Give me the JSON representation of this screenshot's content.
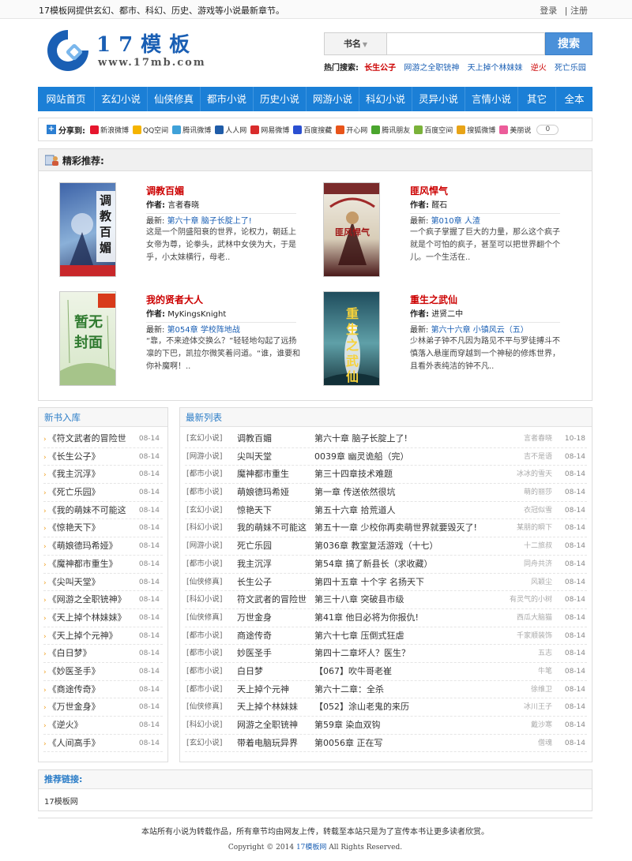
{
  "topbar": {
    "slogan": "17模板网提供玄幻、都市、科幻、历史、游戏等小说最新章节。",
    "login": "登录",
    "sep": "|",
    "register": "注册"
  },
  "logo": {
    "name": "17模板",
    "url": "www.17mb.com"
  },
  "search": {
    "type_label": "书名",
    "value": "",
    "button": "搜索"
  },
  "hot": {
    "label": "热门搜索:",
    "keywords": [
      {
        "text": "长生公子",
        "color": "#cc0000"
      },
      {
        "text": "网游之全职铳神",
        "color": "#1a5fb4"
      },
      {
        "text": "天上掉个林妹妹",
        "color": "#1a5fb4"
      },
      {
        "text": "逆火",
        "color": "#cc0000"
      },
      {
        "text": "死亡乐园",
        "color": "#1a5fb4"
      }
    ]
  },
  "nav": [
    "网站首页",
    "玄幻小说",
    "仙侠修真",
    "都市小说",
    "历史小说",
    "网游小说",
    "科幻小说",
    "灵异小说",
    "言情小说",
    "其它",
    "全本"
  ],
  "share": {
    "label": "分享到:",
    "sites": [
      {
        "text": "新浪微博",
        "color": "#e6162d"
      },
      {
        "text": "QQ空间",
        "color": "#f5b400"
      },
      {
        "text": "腾讯微博",
        "color": "#3fa1d8"
      },
      {
        "text": "人人网",
        "color": "#1f5ca8"
      },
      {
        "text": "网易微博",
        "color": "#d92c2c"
      },
      {
        "text": "百度搜藏",
        "color": "#2a4fd1"
      },
      {
        "text": "开心网",
        "color": "#e8541a"
      },
      {
        "text": "腾讯朋友",
        "color": "#4aa52e"
      },
      {
        "text": "百度空间",
        "color": "#7ab23a"
      },
      {
        "text": "搜狐微博",
        "color": "#e8a417"
      },
      {
        "text": "美丽说",
        "color": "#ec5c9a"
      }
    ],
    "count": "0"
  },
  "recommend": {
    "title": "精彩推荐:",
    "books": [
      {
        "title": "调教百媚",
        "author_label": "作者:",
        "author": "言者春晓",
        "latest_label": "最新:",
        "latest": "第六十章 脑子长腚上了!",
        "desc": "这是一个阴盛阳衰的世界，论权力，朝廷上女帝为尊，论拳头，武林中女侠为大，于是乎，小太妹横行，母老..",
        "cover_text": "调教百媚",
        "cover_bg": "#4a6fb0"
      },
      {
        "title": "匪风悍气",
        "author_label": "作者:",
        "author": "醛石",
        "latest_label": "最新:",
        "latest": "第010章 人渣",
        "desc": "一个疯子掌握了巨大的力量，那么这个疯子就是个可怕的疯子，甚至可以把世界翻个个儿。一个生活在..",
        "cover_text": "匪风悍气",
        "cover_bg": "#7a2b2b"
      },
      {
        "title": "我的贤者大人",
        "author_label": "作者:",
        "author": "MyKingsKnight",
        "latest_label": "最新:",
        "latest": "第054章 学校阵地战",
        "desc": "“靠，不来迹体交换么？”轻轻地勾起了远扬凛的下巴，凯拉尔微笑着问道。“谁，谁要和你补魔啊！..",
        "cover_text": "暂无封面",
        "cover_bg": "#e8f0e0"
      },
      {
        "title": "重生之武仙",
        "author_label": "作者:",
        "author": "进贤二中",
        "latest_label": "最新:",
        "latest": "第六十六章 小镇风云（五）",
        "desc": "少林弟子钟不凡因为路见不平与罗徒搏斗不慎落入悬崖而穿越到一个神秘的修炼世界，且看外表纯洁的钟不凡..",
        "cover_text": "重生之武仙",
        "cover_bg": "#2c6a7a"
      }
    ]
  },
  "new_books": {
    "title": "新书入库",
    "items": [
      {
        "name": "《符文武者的冒险世",
        "date": "08-14"
      },
      {
        "name": "《长生公子》",
        "date": "08-14"
      },
      {
        "name": "《我主沉浮》",
        "date": "08-14"
      },
      {
        "name": "《死亡乐园》",
        "date": "08-14"
      },
      {
        "name": "《我的萌妹不可能这",
        "date": "08-14"
      },
      {
        "name": "《惊艳天下》",
        "date": "08-14"
      },
      {
        "name": "《萌娘德玛希娅》",
        "date": "08-14"
      },
      {
        "name": "《魔神都市重生》",
        "date": "08-14"
      },
      {
        "name": "《尖叫天堂》",
        "date": "08-14"
      },
      {
        "name": "《网游之全职铳神》",
        "date": "08-14"
      },
      {
        "name": "《天上掉个林妹妹》",
        "date": "08-14"
      },
      {
        "name": "《天上掉个元神》",
        "date": "08-14"
      },
      {
        "name": "《白日梦》",
        "date": "08-14"
      },
      {
        "name": "《妙医圣手》",
        "date": "08-14"
      },
      {
        "name": "《商途传奇》",
        "date": "08-14"
      },
      {
        "name": "《万世金身》",
        "date": "08-14"
      },
      {
        "name": "《逆火》",
        "date": "08-14"
      },
      {
        "name": "《人间高手》",
        "date": "08-14"
      }
    ]
  },
  "latest_list": {
    "title": "最新列表",
    "items": [
      {
        "cat": "[玄幻小说]",
        "book": "调教百媚",
        "chapter": "第六十章 脑子长腚上了!",
        "author": "言者春晓",
        "date": "10-18"
      },
      {
        "cat": "[网游小说]",
        "book": "尖叫天堂",
        "chapter": "0039章 幽灵诡船（完）",
        "author": "吉不是语",
        "date": "08-14"
      },
      {
        "cat": "[都市小说]",
        "book": "魔神都市重生",
        "chapter": "第三十四章技术难题",
        "author": "冰冰的雪天",
        "date": "08-14"
      },
      {
        "cat": "[都市小说]",
        "book": "萌娘德玛希娅",
        "chapter": "第一章 传送依然很坑",
        "author": "萌的丽莎",
        "date": "08-14"
      },
      {
        "cat": "[玄幻小说]",
        "book": "惊艳天下",
        "chapter": "第五十六章 拾荒道人",
        "author": "衣冠似雪",
        "date": "08-14"
      },
      {
        "cat": "[科幻小说]",
        "book": "我的萌妹不可能这",
        "chapter": "第五十一章 少校你再卖萌世界就要毁灭了!",
        "author": "某朋的瞬下",
        "date": "08-14"
      },
      {
        "cat": "[网游小说]",
        "book": "死亡乐园",
        "chapter": "第036章 教室复活游戏（十七）",
        "author": "十二旅叔",
        "date": "08-14"
      },
      {
        "cat": "[都市小说]",
        "book": "我主沉浮",
        "chapter": "第54章 搞了新县长（求收藏）",
        "author": "同舟共济",
        "date": "08-14"
      },
      {
        "cat": "[仙侠修真]",
        "book": "长生公子",
        "chapter": "第四十五章 十个字 名扬天下",
        "author": "风颖尘",
        "date": "08-14"
      },
      {
        "cat": "[科幻小说]",
        "book": "符文武者的冒险世",
        "chapter": "第三十八章 突破县市级",
        "author": "有灵气的小树",
        "date": "08-14"
      },
      {
        "cat": "[仙侠修真]",
        "book": "万世金身",
        "chapter": "第41章 他日必将为你报仇!",
        "author": "西瓜大脑猫",
        "date": "08-14"
      },
      {
        "cat": "[都市小说]",
        "book": "商途传奇",
        "chapter": "第六十七章 压倒式狂虐",
        "author": "千家顺装饰",
        "date": "08-14"
      },
      {
        "cat": "[都市小说]",
        "book": "妙医圣手",
        "chapter": "第四十二章坏人？医生？",
        "author": "五志",
        "date": "08-14"
      },
      {
        "cat": "[都市小说]",
        "book": "白日梦",
        "chapter": "【067】吹牛哥老崔",
        "author": "牛笔",
        "date": "08-14"
      },
      {
        "cat": "[都市小说]",
        "book": "天上掉个元神",
        "chapter": "第六十二章：全杀",
        "author": "徐维卫",
        "date": "08-14"
      },
      {
        "cat": "[仙侠修真]",
        "book": "天上掉个林妹妹",
        "chapter": "【052】涂山老鬼的来历",
        "author": "冰川王子",
        "date": "08-14"
      },
      {
        "cat": "[科幻小说]",
        "book": "网游之全职铳神",
        "chapter": "第59章 染血双钩",
        "author": "戴沙寒",
        "date": "08-14"
      },
      {
        "cat": "[玄幻小说]",
        "book": "带着电脑玩异界",
        "chapter": "第0056章 正在写",
        "author": "僧魂",
        "date": "08-14"
      }
    ]
  },
  "friend_links": {
    "title": "推荐链接:",
    "items": [
      "17模板网"
    ]
  },
  "footer": {
    "line1": "本站所有小说为转载作品，所有章节均由网友上传，转载至本站只是为了宣传本书让更多读者欣赏。",
    "copyright_prefix": "Copyright © 2014",
    "site": "17模板网",
    "copyright_suffix": "All Rights Reserved."
  },
  "colors": {
    "nav_bg": "#1b7fd6",
    "search_button": "#4a90d9",
    "title_red": "#cc0000",
    "link_blue": "#1a5fb4"
  }
}
